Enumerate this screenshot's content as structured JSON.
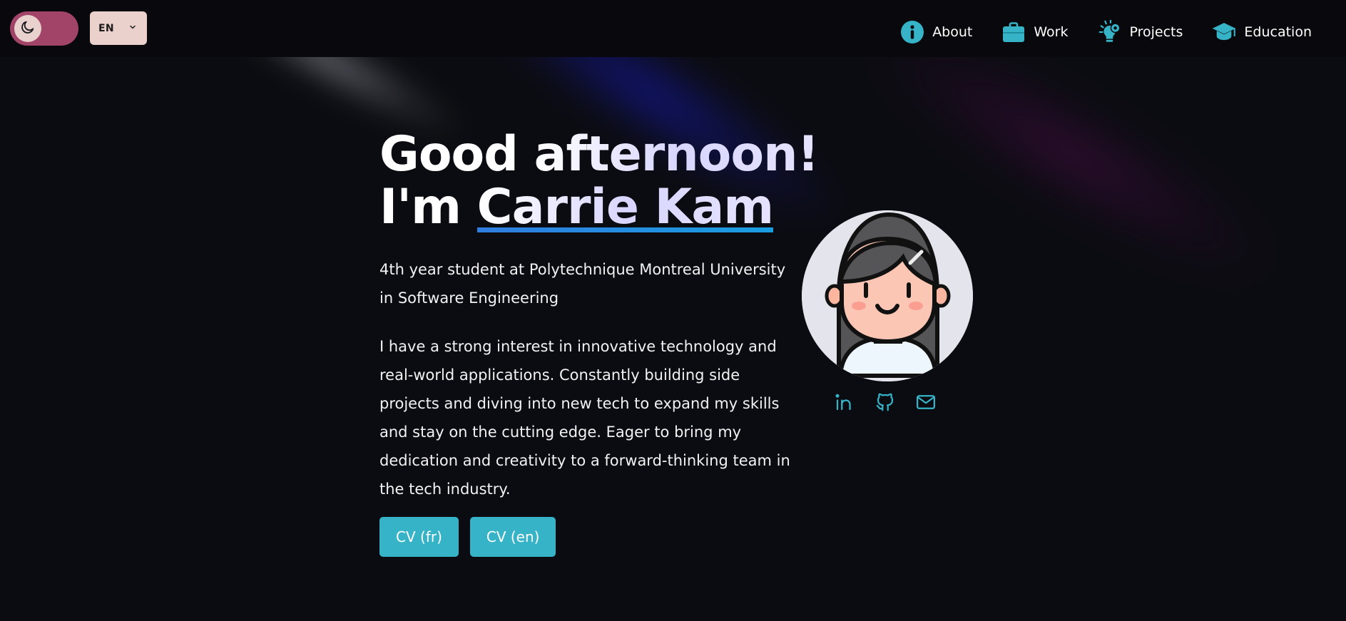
{
  "header": {
    "language": "EN",
    "nav": [
      {
        "label": "About",
        "icon": "info-icon"
      },
      {
        "label": "Work",
        "icon": "briefcase-icon"
      },
      {
        "label": "Projects",
        "icon": "lightbulb-gear-icon"
      },
      {
        "label": "Education",
        "icon": "graduation-cap-icon"
      }
    ]
  },
  "hero": {
    "greeting_plain": "Good",
    "greeting_gradient": "afternoon!",
    "intro_plain": "I'm",
    "name": "Carrie Kam",
    "subtitle": "4th year student at Polytechnique Montreal University in Software Engineering",
    "bio": "I have a strong interest in innovative technology and real-world applications. Constantly building side projects and diving into new tech to expand my skills and stay on the cutting edge. Eager to bring my dedication and creativity to a forward-thinking team in the tech industry.",
    "cv_buttons": [
      {
        "label": "CV (fr)"
      },
      {
        "label": "CV (en)"
      }
    ]
  },
  "socials": [
    {
      "icon": "linkedin-icon"
    },
    {
      "icon": "github-icon"
    },
    {
      "icon": "mail-icon"
    }
  ],
  "colors": {
    "background": "#0b0c11",
    "accent": "#36b3c7",
    "toggle": "#a24368",
    "underline": "#2f7ddf"
  }
}
